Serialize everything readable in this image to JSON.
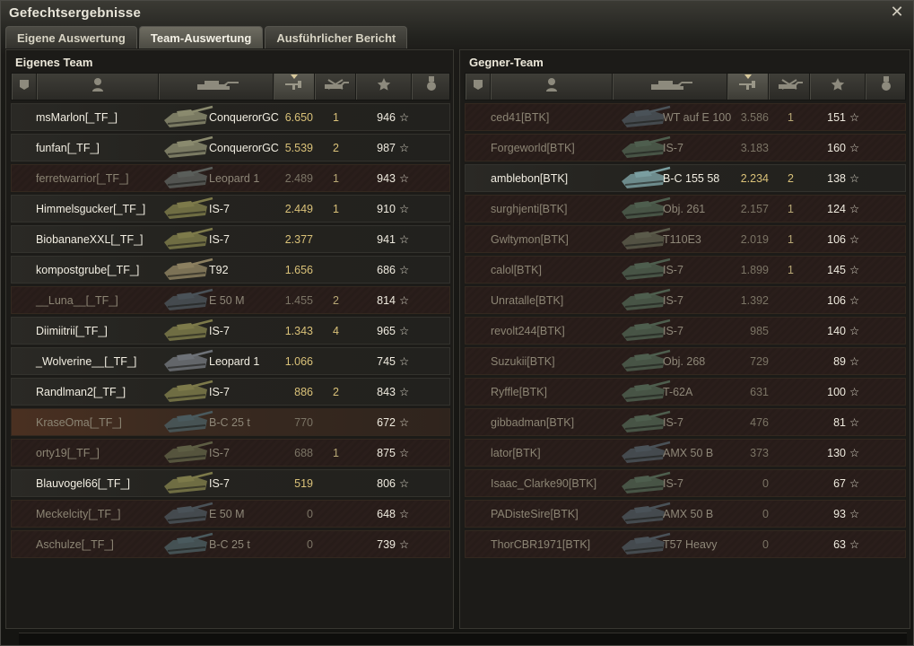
{
  "window": {
    "title": "Gefechtsergebnisse",
    "close_label": "✕"
  },
  "tabs": [
    {
      "label": "Eigene Auswertung",
      "active": false
    },
    {
      "label": "Team-Auswertung",
      "active": true
    },
    {
      "label": "Ausführlicher Bericht",
      "active": false
    }
  ],
  "columns": [
    "platoon-icon",
    "player-icon",
    "tank-icon",
    "damage-icon",
    "kills-icon",
    "xp-star-icon",
    "medal-icon"
  ],
  "sorted_column": "damage-icon",
  "colors": {
    "damage": "#d9c178",
    "dead_text": "#8c8574",
    "highlight_row": "#4a3021"
  },
  "own_team": {
    "title": "Eigenes Team",
    "players": [
      {
        "name": "msMarlon[_TF_]",
        "tank": "ConquerorGC",
        "damage": "6.650",
        "kills": "1",
        "xp": "946",
        "dead": false,
        "tank_color": "#8a8a6e"
      },
      {
        "name": "funfan[_TF_]",
        "tank": "ConquerorGC",
        "damage": "5.539",
        "kills": "2",
        "xp": "987",
        "dead": false,
        "tank_color": "#8a8a6e"
      },
      {
        "name": "ferretwarrior[_TF_]",
        "tank": "Leopard 1",
        "damage": "2.489",
        "kills": "1",
        "xp": "943",
        "dead": true,
        "tank_color": "#5a5e5a"
      },
      {
        "name": "Himmelsgucker[_TF_]",
        "tank": "IS-7",
        "damage": "2.449",
        "kills": "1",
        "xp": "910",
        "dead": false,
        "tank_color": "#7d7a4a"
      },
      {
        "name": "BiobananeXXL[_TF_]",
        "tank": "IS-7",
        "damage": "2.377",
        "kills": "",
        "xp": "941",
        "dead": false,
        "tank_color": "#7d7a4a"
      },
      {
        "name": "kompostgrube[_TF_]",
        "tank": "T92",
        "damage": "1.656",
        "kills": "",
        "xp": "686",
        "dead": false,
        "tank_color": "#8c8060"
      },
      {
        "name": "__Luna__[_TF_]",
        "tank": "E 50 M",
        "damage": "1.455",
        "kills": "2",
        "xp": "814",
        "dead": true,
        "tank_color": "#4a5258"
      },
      {
        "name": "Diimiitrii[_TF_]",
        "tank": "IS-7",
        "damage": "1.343",
        "kills": "4",
        "xp": "965",
        "dead": false,
        "tank_color": "#7d7a4a"
      },
      {
        "name": "_Wolverine__[_TF_]",
        "tank": "Leopard 1",
        "damage": "1.066",
        "kills": "",
        "xp": "745",
        "dead": false,
        "tank_color": "#6e7278"
      },
      {
        "name": "Randlman2[_TF_]",
        "tank": "IS-7",
        "damage": "886",
        "kills": "2",
        "xp": "843",
        "dead": false,
        "tank_color": "#7d7a4a"
      },
      {
        "name": "KraseOma[_TF_]",
        "tank": "B-C 25 t",
        "damage": "770",
        "kills": "",
        "xp": "672",
        "dead": true,
        "highlight": true,
        "tank_color": "#4a5a5e"
      },
      {
        "name": "orty19[_TF_]",
        "tank": "IS-7",
        "damage": "688",
        "kills": "1",
        "xp": "875",
        "dead": true,
        "tank_color": "#5e5e44"
      },
      {
        "name": "Blauvogel66[_TF_]",
        "tank": "IS-7",
        "damage": "519",
        "kills": "",
        "xp": "806",
        "dead": false,
        "tank_color": "#7d7a4a"
      },
      {
        "name": "Meckelcity[_TF_]",
        "tank": "E 50 M",
        "damage": "0",
        "kills": "",
        "xp": "648",
        "dead": true,
        "tank_color": "#4a5258"
      },
      {
        "name": "Aschulze[_TF_]",
        "tank": "B-C 25 t",
        "damage": "0",
        "kills": "",
        "xp": "739",
        "dead": true,
        "tank_color": "#4a5a5e"
      }
    ]
  },
  "enemy_team": {
    "title": "Gegner-Team",
    "players": [
      {
        "name": "ced41[BTK]",
        "tank": "WT auf E 100",
        "damage": "3.586",
        "kills": "1",
        "xp": "151",
        "dead": true,
        "tank_color": "#4a5258"
      },
      {
        "name": "Forgeworld[BTK]",
        "tank": "IS-7",
        "damage": "3.183",
        "kills": "",
        "xp": "160",
        "dead": true,
        "tank_color": "#4e5e4e"
      },
      {
        "name": "amblebon[BTK]",
        "tank": "B-C 155 58",
        "damage": "2.234",
        "kills": "2",
        "xp": "138",
        "dead": false,
        "tank_color": "#7a9ea0"
      },
      {
        "name": "surghjenti[BTK]",
        "tank": "Obj. 261",
        "damage": "2.157",
        "kills": "1",
        "xp": "124",
        "dead": true,
        "tank_color": "#4e5e4e"
      },
      {
        "name": "Gwltymon[BTK]",
        "tank": "T110E3",
        "damage": "2.019",
        "kills": "1",
        "xp": "106",
        "dead": true,
        "tank_color": "#5a5a4a"
      },
      {
        "name": "calol[BTK]",
        "tank": "IS-7",
        "damage": "1.899",
        "kills": "1",
        "xp": "145",
        "dead": true,
        "tank_color": "#4e5e4e"
      },
      {
        "name": "Unratalle[BTK]",
        "tank": "IS-7",
        "damage": "1.392",
        "kills": "",
        "xp": "106",
        "dead": true,
        "tank_color": "#4e5e4e"
      },
      {
        "name": "revolt244[BTK]",
        "tank": "IS-7",
        "damage": "985",
        "kills": "",
        "xp": "140",
        "dead": true,
        "tank_color": "#4e5e4e"
      },
      {
        "name": "Suzukii[BTK]",
        "tank": "Obj. 268",
        "damage": "729",
        "kills": "",
        "xp": "89",
        "dead": true,
        "tank_color": "#4e5e4e"
      },
      {
        "name": "Ryffle[BTK]",
        "tank": "T-62A",
        "damage": "631",
        "kills": "",
        "xp": "100",
        "dead": true,
        "tank_color": "#4e5e4e"
      },
      {
        "name": "gibbadman[BTK]",
        "tank": "IS-7",
        "damage": "476",
        "kills": "",
        "xp": "81",
        "dead": true,
        "tank_color": "#4e5e4e"
      },
      {
        "name": "lator[BTK]",
        "tank": "AMX 50 B",
        "damage": "373",
        "kills": "",
        "xp": "130",
        "dead": true,
        "tank_color": "#4a5258"
      },
      {
        "name": "Isaac_Clarke90[BTK]",
        "tank": "IS-7",
        "damage": "0",
        "kills": "",
        "xp": "67",
        "dead": true,
        "tank_color": "#4e5e4e"
      },
      {
        "name": "PADisteSire[BTK]",
        "tank": "AMX 50 B",
        "damage": "0",
        "kills": "",
        "xp": "93",
        "dead": true,
        "tank_color": "#4a5258"
      },
      {
        "name": "ThorCBR1971[BTK]",
        "tank": "T57 Heavy",
        "damage": "0",
        "kills": "",
        "xp": "63",
        "dead": true,
        "tank_color": "#4a5258"
      }
    ]
  }
}
